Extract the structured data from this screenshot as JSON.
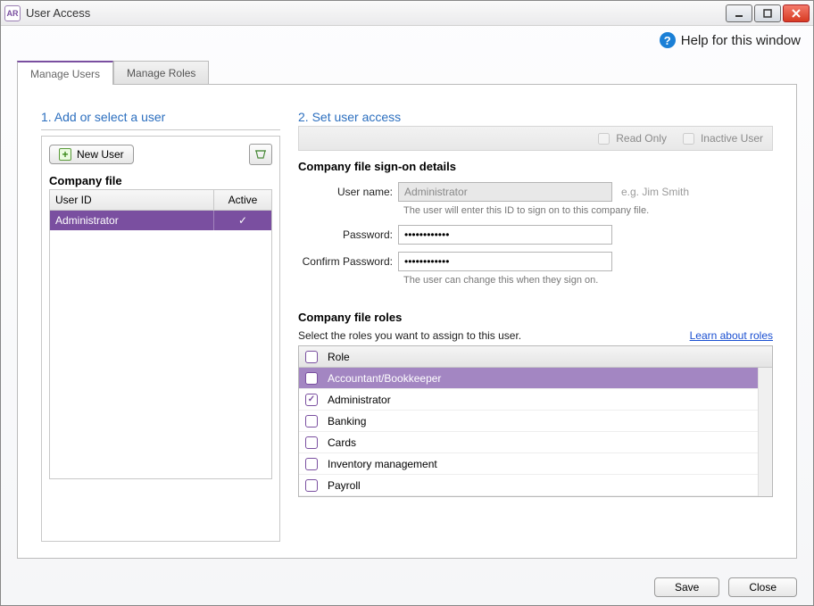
{
  "window": {
    "title": "User Access",
    "app_icon_text": "AR"
  },
  "help": {
    "label": "Help for this window"
  },
  "tabs": {
    "manage_users": "Manage Users",
    "manage_roles": "Manage Roles"
  },
  "left": {
    "section_title": "1. Add or select a user",
    "new_user_label": "New User",
    "company_file_label": "Company file",
    "columns": {
      "user_id": "User ID",
      "active": "Active"
    },
    "rows": [
      {
        "user_id": "Administrator",
        "active": true,
        "selected": true
      }
    ]
  },
  "right": {
    "section_title": "2. Set user access",
    "read_only_label": "Read Only",
    "inactive_user_label": "Inactive User",
    "signon_title": "Company file sign-on details",
    "username_label": "User name:",
    "username_value": "Administrator",
    "username_example": "e.g. Jim Smith",
    "username_hint": "The user will enter this ID to sign on to this company file.",
    "password_label": "Password:",
    "password_value": "************",
    "confirm_label": "Confirm Password:",
    "confirm_value": "************",
    "password_hint": "The user can change this when they sign on.",
    "roles_title": "Company file roles",
    "roles_desc": "Select the roles you want to assign to this user.",
    "learn_link": "Learn about roles",
    "roles_header": "Role",
    "roles": [
      {
        "name": "Accountant/Bookkeeper",
        "checked": false,
        "selected": true
      },
      {
        "name": "Administrator",
        "checked": true,
        "selected": false
      },
      {
        "name": "Banking",
        "checked": false,
        "selected": false
      },
      {
        "name": "Cards",
        "checked": false,
        "selected": false
      },
      {
        "name": "Inventory management",
        "checked": false,
        "selected": false
      },
      {
        "name": "Payroll",
        "checked": false,
        "selected": false
      }
    ]
  },
  "footer": {
    "save": "Save",
    "close": "Close"
  }
}
